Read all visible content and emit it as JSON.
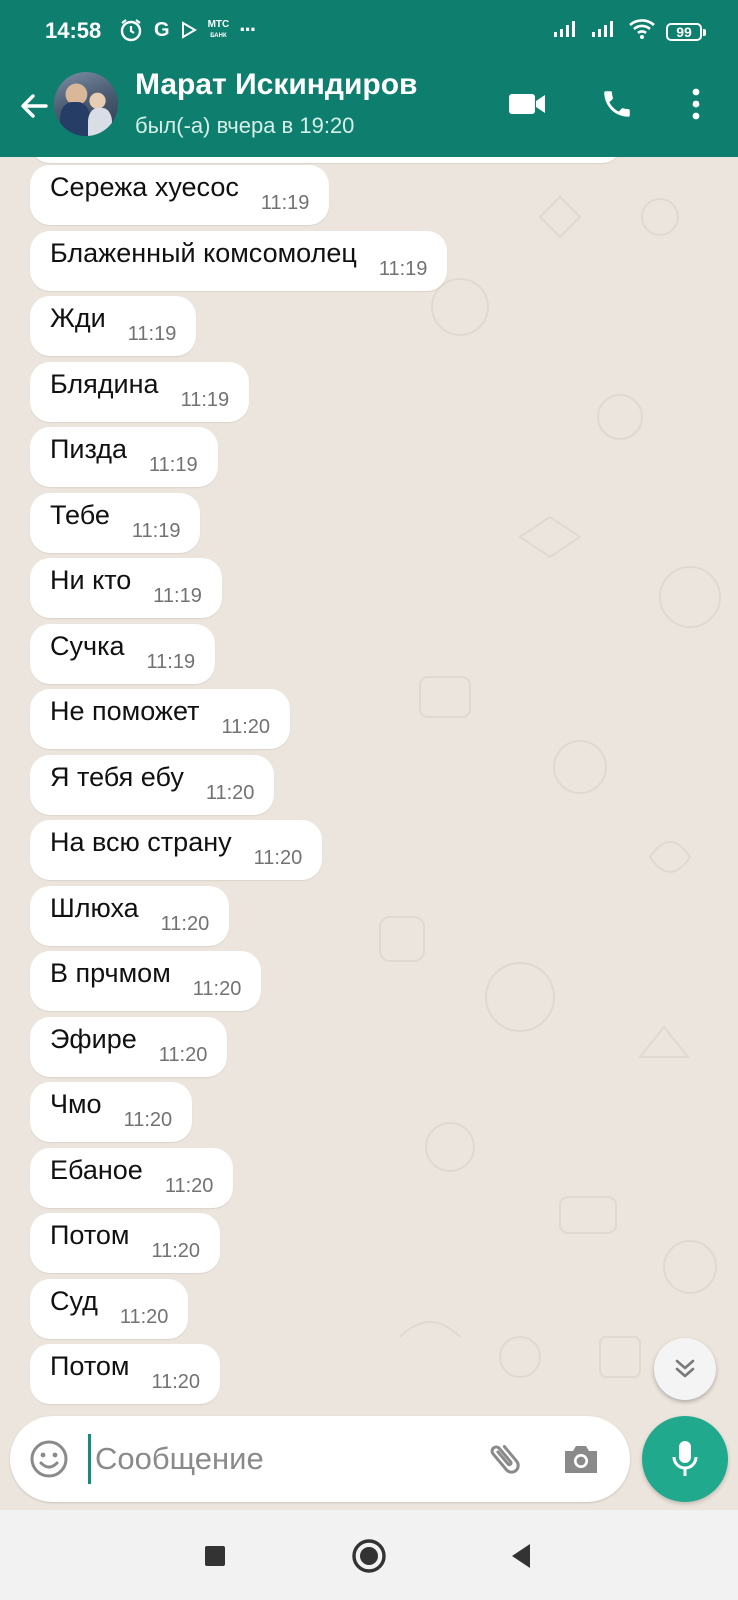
{
  "status_bar": {
    "time": "14:58",
    "g_label": "G",
    "mts_label": "МТС",
    "mts_sub": "БАНК",
    "more": "···",
    "battery": "99",
    "icons": [
      "alarm-icon",
      "g-icon",
      "play-icon",
      "mts-bank-icon",
      "more-icon",
      "signal-icon",
      "signal-icon",
      "wifi-icon",
      "battery-icon"
    ]
  },
  "header": {
    "contact_name": "Марат Искиндиров",
    "contact_status": "был(-а) вчера в 19:20",
    "icons": [
      "back-arrow-icon",
      "avatar",
      "video-call-icon",
      "phone-icon",
      "more-vert-icon"
    ]
  },
  "messages": [
    {
      "text": "Сережа хуесос",
      "time": "11:19"
    },
    {
      "text": "Блаженный комсомолец",
      "time": "11:19"
    },
    {
      "text": "Жди",
      "time": "11:19"
    },
    {
      "text": "Блядина",
      "time": "11:19"
    },
    {
      "text": "Пизда",
      "time": "11:19"
    },
    {
      "text": "Тебе",
      "time": "11:19"
    },
    {
      "text": "Ни кто",
      "time": "11:19"
    },
    {
      "text": "Сучка",
      "time": "11:19"
    },
    {
      "text": "Не поможет",
      "time": "11:20"
    },
    {
      "text": "Я тебя ебу",
      "time": "11:20"
    },
    {
      "text": "На всю страну",
      "time": "11:20"
    },
    {
      "text": "Шлюха",
      "time": "11:20"
    },
    {
      "text": "В прчмом",
      "time": "11:20"
    },
    {
      "text": "Эфире",
      "time": "11:20"
    },
    {
      "text": "Чмо",
      "time": "11:20"
    },
    {
      "text": "Ебаное",
      "time": "11:20"
    },
    {
      "text": "Потом",
      "time": "11:20"
    },
    {
      "text": "Суд",
      "time": "11:20"
    },
    {
      "text": "Потом",
      "time": "11:20"
    }
  ],
  "input": {
    "placeholder": "Сообщение",
    "value": "",
    "icons": [
      "emoji-icon",
      "attach-icon",
      "camera-icon",
      "mic-icon"
    ]
  },
  "nav_bar": {
    "icons": [
      "recents-icon",
      "home-icon",
      "back-icon"
    ]
  },
  "colors": {
    "header": "#0e7f6e",
    "chat_background": "#ece5dd",
    "bubble": "#ffffff",
    "accent": "#20a98c",
    "time_text": "#727272"
  }
}
